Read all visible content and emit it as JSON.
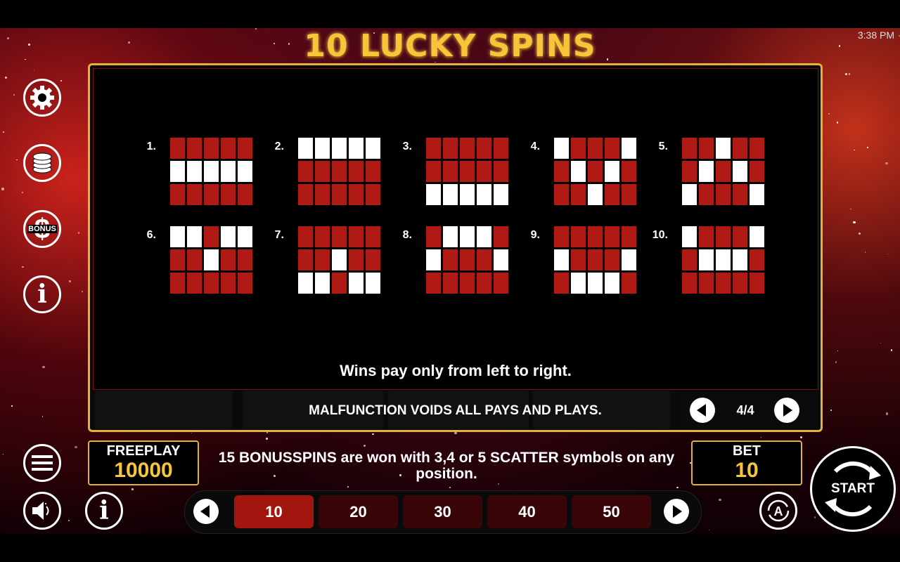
{
  "status_bar": {
    "time": "3:38 PM"
  },
  "game": {
    "logo_text": "10 LUCKY SPINS"
  },
  "side_menu": {
    "settings_icon": "gear-icon",
    "coins_icon": "coin-stack-icon",
    "bonus_label": "BONUS",
    "info_icon": "info-icon"
  },
  "paytable": {
    "page": "4/4",
    "lines": [
      {
        "num": "1.",
        "pattern": [
          [
            0,
            0,
            0,
            0,
            0
          ],
          [
            1,
            1,
            1,
            1,
            1
          ],
          [
            0,
            0,
            0,
            0,
            0
          ]
        ]
      },
      {
        "num": "2.",
        "pattern": [
          [
            1,
            1,
            1,
            1,
            1
          ],
          [
            0,
            0,
            0,
            0,
            0
          ],
          [
            0,
            0,
            0,
            0,
            0
          ]
        ]
      },
      {
        "num": "3.",
        "pattern": [
          [
            0,
            0,
            0,
            0,
            0
          ],
          [
            0,
            0,
            0,
            0,
            0
          ],
          [
            1,
            1,
            1,
            1,
            1
          ]
        ]
      },
      {
        "num": "4.",
        "pattern": [
          [
            1,
            0,
            0,
            0,
            1
          ],
          [
            0,
            1,
            0,
            1,
            0
          ],
          [
            0,
            0,
            1,
            0,
            0
          ]
        ]
      },
      {
        "num": "5.",
        "pattern": [
          [
            0,
            0,
            1,
            0,
            0
          ],
          [
            0,
            1,
            0,
            1,
            0
          ],
          [
            1,
            0,
            0,
            0,
            1
          ]
        ]
      },
      {
        "num": "6.",
        "pattern": [
          [
            1,
            1,
            0,
            1,
            1
          ],
          [
            0,
            0,
            1,
            0,
            0
          ],
          [
            0,
            0,
            0,
            0,
            0
          ]
        ]
      },
      {
        "num": "7.",
        "pattern": [
          [
            0,
            0,
            0,
            0,
            0
          ],
          [
            0,
            0,
            1,
            0,
            0
          ],
          [
            1,
            1,
            0,
            1,
            1
          ]
        ]
      },
      {
        "num": "8.",
        "pattern": [
          [
            0,
            1,
            1,
            1,
            0
          ],
          [
            1,
            0,
            0,
            0,
            1
          ],
          [
            0,
            0,
            0,
            0,
            0
          ]
        ]
      },
      {
        "num": "9.",
        "pattern": [
          [
            0,
            0,
            0,
            0,
            0
          ],
          [
            1,
            0,
            0,
            0,
            1
          ],
          [
            0,
            1,
            1,
            1,
            0
          ]
        ]
      },
      {
        "num": "10.",
        "pattern": [
          [
            1,
            0,
            0,
            0,
            1
          ],
          [
            0,
            1,
            1,
            1,
            0
          ],
          [
            0,
            0,
            0,
            0,
            0
          ]
        ]
      }
    ],
    "wins_note": "Wins pay only from left to right.",
    "malfunction": "MALFUNCTION VOIDS ALL PAYS AND PLAYS."
  },
  "freeplay": {
    "label": "FREEPLAY",
    "value": "10000"
  },
  "message": "15 BONUSSPINS are won with 3,4 or 5 SCATTER symbols on any position.",
  "bet": {
    "label": "BET",
    "value": "10"
  },
  "bet_options": [
    "10",
    "20",
    "30",
    "40",
    "50"
  ],
  "bet_selected": "10",
  "start_label": "START",
  "colors": {
    "gold": "#e3b23a",
    "line_red": "#b01a14",
    "selected_bet": "#a3150f"
  }
}
